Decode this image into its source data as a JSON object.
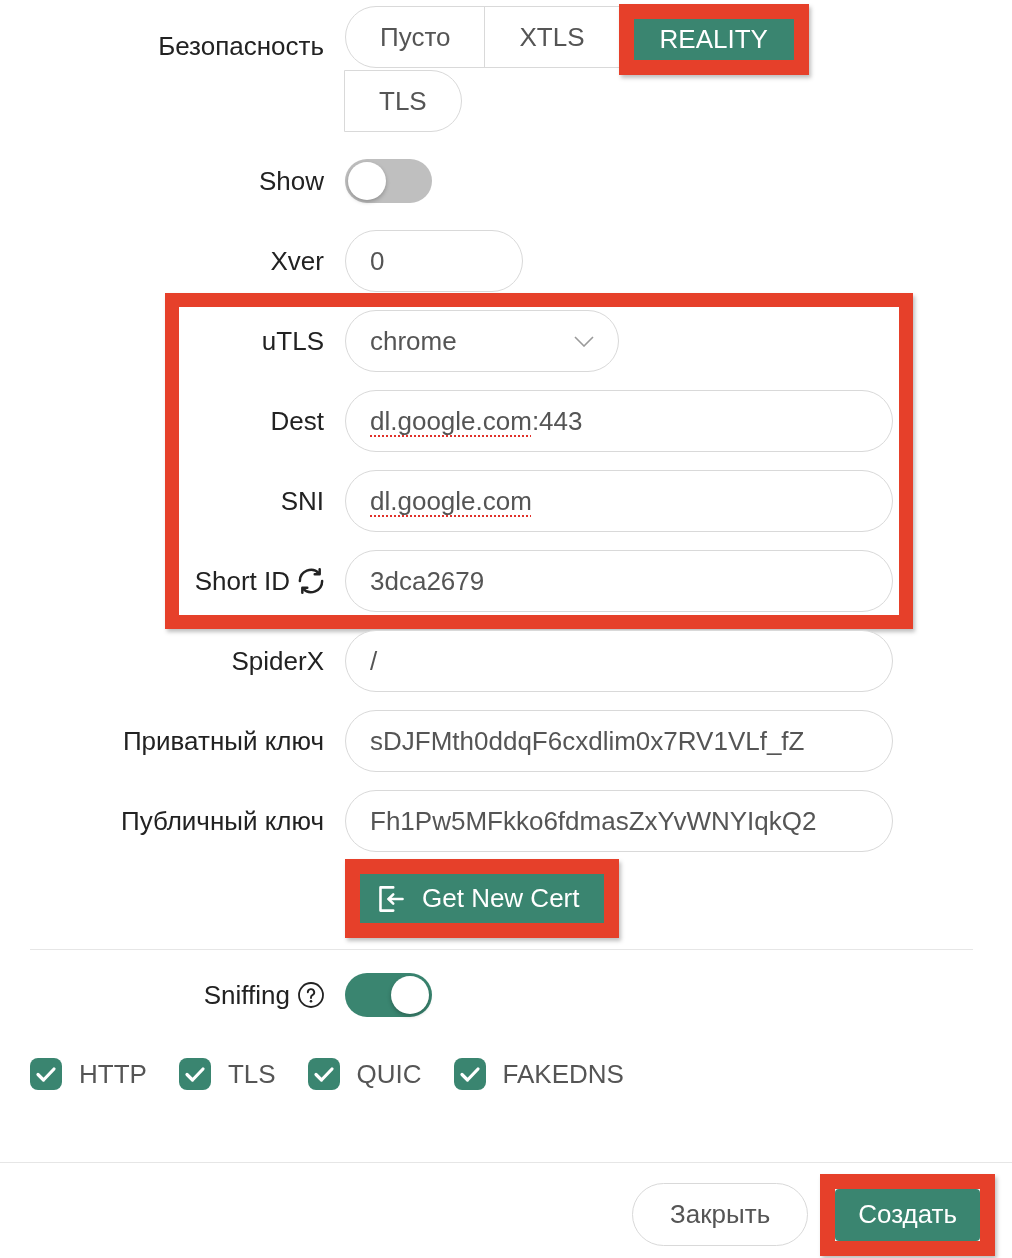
{
  "fields": [
    {
      "kind": "radio",
      "label": "Безопасность",
      "highlighted": false,
      "options": [
        {
          "label": "Пусто",
          "selected": false,
          "highlighted": false
        },
        {
          "label": "XTLS",
          "selected": false,
          "highlighted": false
        },
        {
          "label": "REALITY",
          "selected": true,
          "highlighted": true
        },
        {
          "label": "TLS",
          "selected": false,
          "highlighted": false
        }
      ]
    },
    {
      "kind": "toggle",
      "label": "Show",
      "on": false,
      "highlighted": false
    },
    {
      "kind": "number",
      "label": "Xver",
      "value_parts": [
        {
          "text": "0",
          "misspelled": false
        }
      ],
      "highlighted": false
    },
    {
      "kind": "select",
      "label": "uTLS",
      "value": "chrome",
      "highlighted": true
    },
    {
      "kind": "text",
      "label": "Dest",
      "value_parts": [
        {
          "text": "dl.google.com",
          "misspelled": true
        },
        {
          "text": ":443",
          "misspelled": false
        }
      ],
      "highlighted": true
    },
    {
      "kind": "text",
      "label": "SNI",
      "value_parts": [
        {
          "text": "dl.google.com",
          "misspelled": true
        }
      ],
      "highlighted": true
    },
    {
      "kind": "generated",
      "label": "Short ID",
      "value_parts": [
        {
          "text": "3dca2679",
          "misspelled": false
        }
      ],
      "highlighted": true
    },
    {
      "kind": "text",
      "label": "SpiderX",
      "value_parts": [
        {
          "text": "/",
          "misspelled": false
        }
      ],
      "highlighted": false
    },
    {
      "kind": "text",
      "label": "Приватный ключ",
      "value_parts": [
        {
          "text": "sDJFMth0ddqF6cxdlim0x7RV1VLf_fZ",
          "misspelled": false
        }
      ],
      "highlighted": false
    },
    {
      "kind": "text",
      "label": "Публичный ключ",
      "value_parts": [
        {
          "text": "Fh1Pw5MFkko6fdmasZxYvWNYIqkQ2",
          "misspelled": false
        }
      ],
      "highlighted": false
    },
    {
      "kind": "button",
      "text": "Get New Cert",
      "highlighted": true
    }
  ],
  "sniffing": {
    "label": "Sniffing",
    "on": true,
    "protocols": [
      {
        "label": "HTTP",
        "checked": true
      },
      {
        "label": "TLS",
        "checked": true
      },
      {
        "label": "QUIC",
        "checked": true
      },
      {
        "label": "FAKEDNS",
        "checked": true
      }
    ]
  },
  "footer": {
    "buttons": [
      {
        "label": "Закрыть",
        "primary": false,
        "highlighted": false
      },
      {
        "label": "Создать",
        "primary": true,
        "highlighted": true
      }
    ]
  }
}
